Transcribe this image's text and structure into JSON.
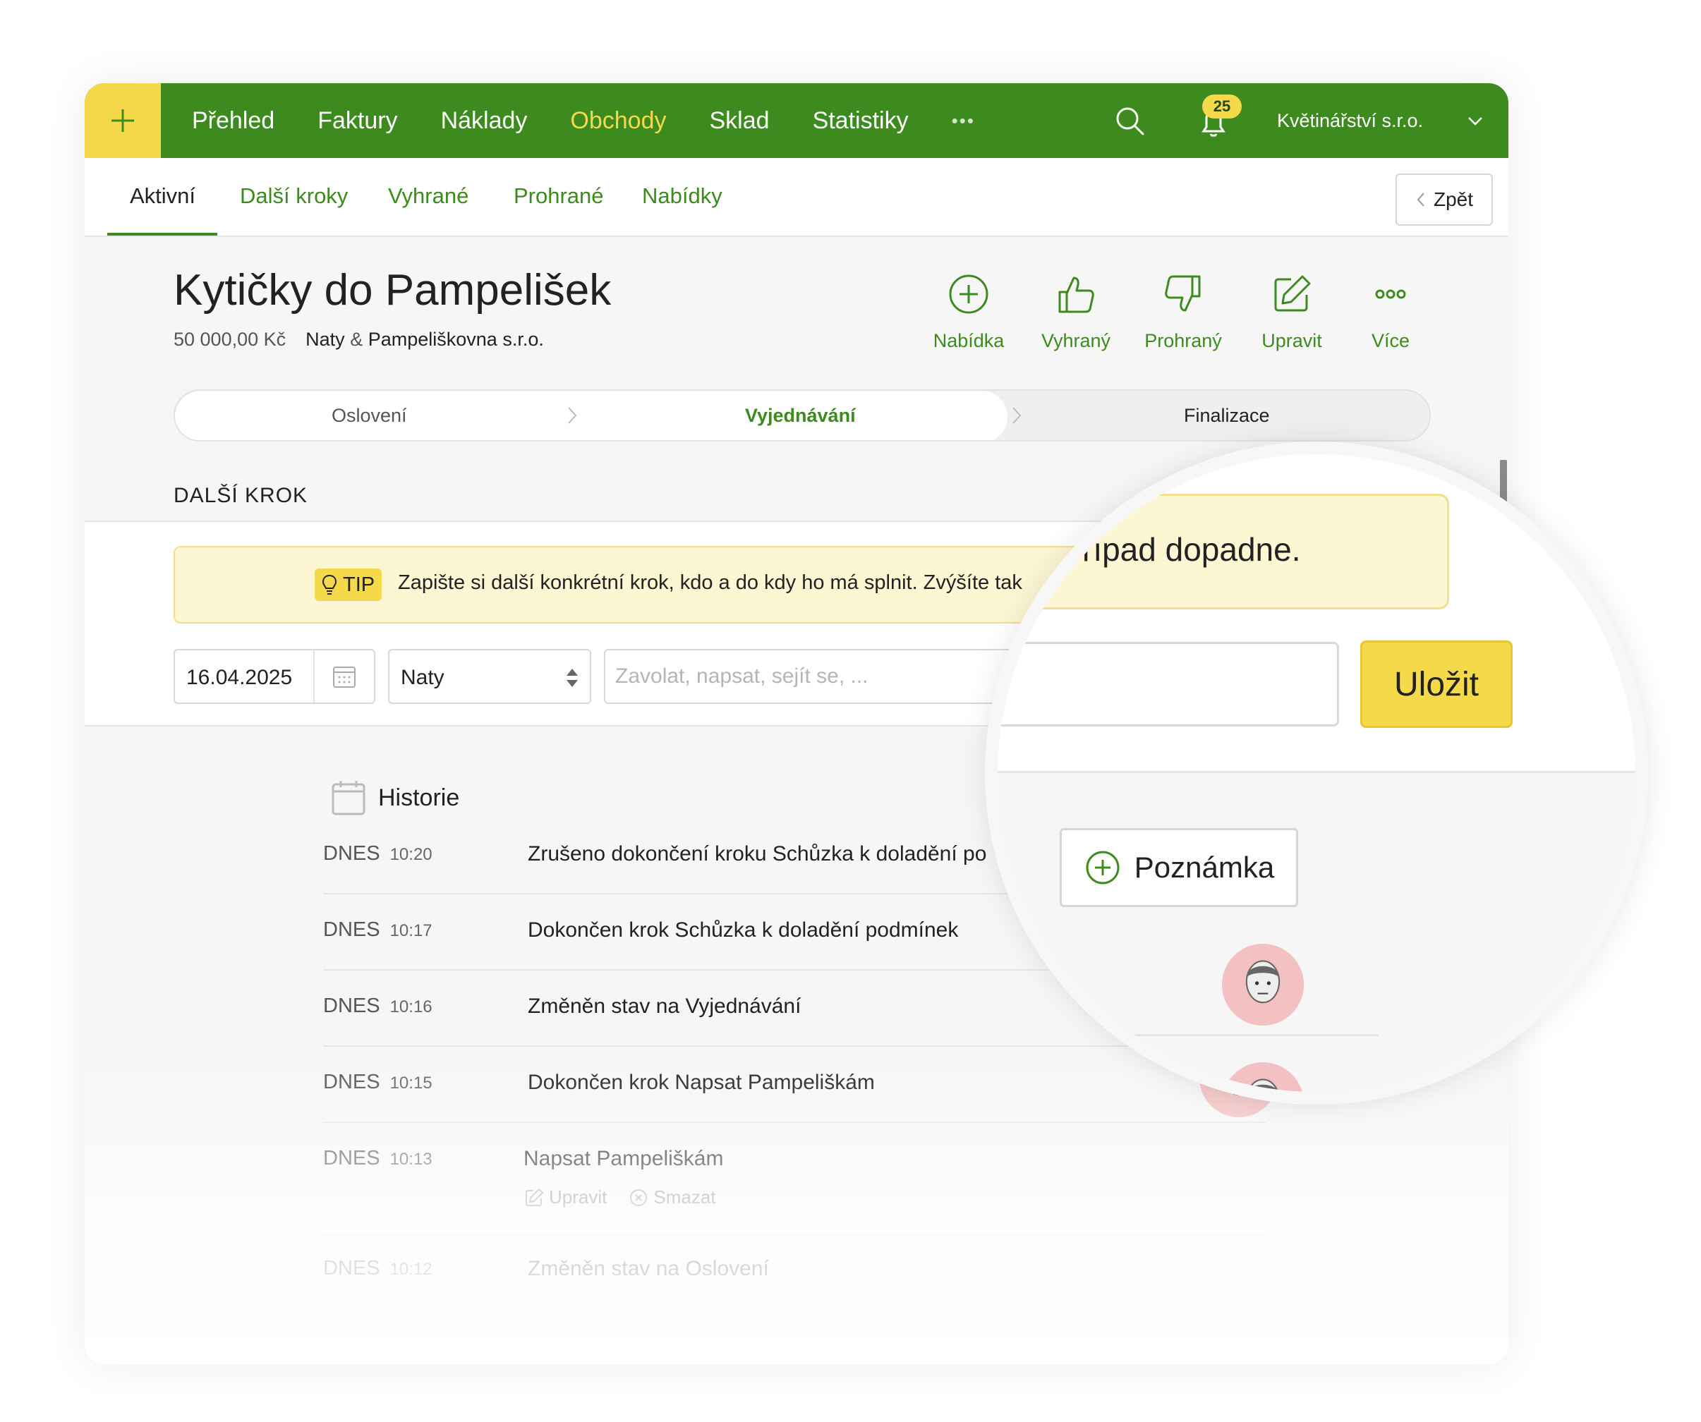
{
  "colors": {
    "brand_green": "#3d8b1e",
    "accent_yellow": "#f4d94a",
    "tip_bg": "#fdf6d3"
  },
  "topbar": {
    "add_icon": "plus-icon",
    "nav": [
      "Přehled",
      "Faktury",
      "Náklady",
      "Obchody",
      "Sklad",
      "Statistiky"
    ],
    "active_nav": "Obchody",
    "more": "•••",
    "notification_count": "25",
    "company": "Květinářství s.r.o."
  },
  "subnav": {
    "tabs": [
      "Aktivní",
      "Další kroky",
      "Vyhrané",
      "Prohrané",
      "Nabídky"
    ],
    "active_tab": "Aktivní",
    "back_label": "Zpět"
  },
  "deal": {
    "title": "Kytičky do Pampelišek",
    "amount": "50 000,00 Kč",
    "client_person": "Naty",
    "client_sep": "&",
    "client_company": "Pampeliškovna s.r.o."
  },
  "actions": [
    {
      "label": "Nabídka",
      "icon": "plus-circle-icon"
    },
    {
      "label": "Vyhraný",
      "icon": "thumbs-up-icon"
    },
    {
      "label": "Prohraný",
      "icon": "thumbs-down-icon"
    },
    {
      "label": "Upravit",
      "icon": "edit-icon"
    },
    {
      "label": "Více",
      "icon": "more-icon"
    }
  ],
  "pipeline": {
    "stages": [
      "Oslovení",
      "Vyjednávání",
      "Finalizace"
    ],
    "current": "Vyjednávání"
  },
  "next_step": {
    "section_label": "DALŠÍ KROK",
    "tip_badge": "TIP",
    "tip_text": "Zapište si další konkrétní krok, kdo a do kdy ho má splnit. Zvýšíte tak",
    "tip_text_end": "řípad dopadne.",
    "date": "16.04.2025",
    "person": "Naty",
    "task_placeholder": "Zavolat, napsat, sejít se, ...",
    "save_label": "Uložit"
  },
  "history": {
    "title": "Historie",
    "note_button": "Poznámka",
    "rows": [
      {
        "day": "DNES",
        "time": "10:20",
        "text": "Zrušeno dokončení kroku Schůzka k doladění po"
      },
      {
        "day": "DNES",
        "time": "10:17",
        "text": "Dokončen krok Schůzka k doladění podmínek"
      },
      {
        "day": "DNES",
        "time": "10:16",
        "text": "Změněn stav na Vyjednávání"
      },
      {
        "day": "DNES",
        "time": "10:15",
        "text": "Dokončen krok Napsat Pampeliškám"
      },
      {
        "day": "DNES",
        "time": "10:13",
        "text": "Napsat Pampeliškám",
        "edit": "Upravit",
        "delete": "Smazat"
      },
      {
        "day": "DNES",
        "time": "10:12",
        "text": "Změněn stav na Oslovení"
      }
    ]
  }
}
